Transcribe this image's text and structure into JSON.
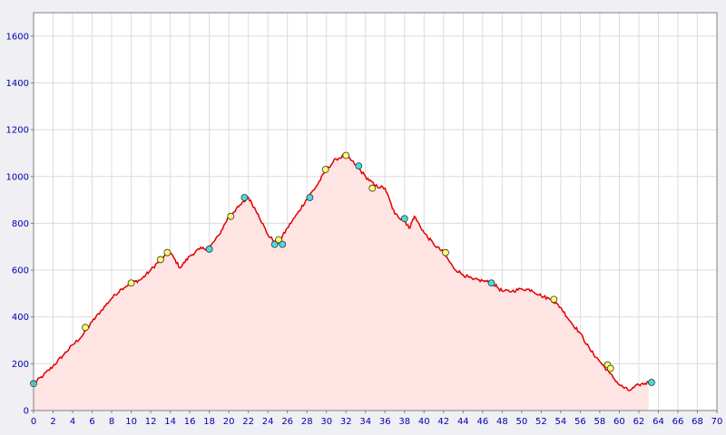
{
  "chart_data": {
    "type": "area",
    "title": "",
    "xlabel": "",
    "ylabel": "",
    "xlim": [
      0,
      70
    ],
    "ylim": [
      0,
      1700
    ],
    "x_ticks": [
      "0",
      "2",
      "4",
      "6",
      "8",
      "10",
      "12",
      "14",
      "16",
      "18",
      "20",
      "22",
      "24",
      "26",
      "28",
      "30",
      "32",
      "34",
      "36",
      "38",
      "40",
      "42",
      "44",
      "46",
      "48",
      "50",
      "52",
      "54",
      "56",
      "58",
      "60",
      "62",
      "64",
      "66",
      "68",
      "70"
    ],
    "y_ticks": [
      "0",
      "200",
      "400",
      "600",
      "800",
      "1000",
      "1200",
      "1400",
      "1600"
    ],
    "grid": true,
    "colors": {
      "line": "#e00000",
      "fill": "#ffe4e4",
      "plot_bg": "#ffffff",
      "page_bg": "#efeff4",
      "grid": "#dcdcdc",
      "marker_yellow": "#ffff66",
      "marker_cyan": "#44dddd"
    },
    "series": [
      {
        "x": [
          0,
          1,
          2,
          3,
          4,
          5,
          6,
          7,
          8,
          9,
          10,
          11,
          12,
          13,
          14,
          15,
          16,
          17,
          18,
          19,
          20,
          21,
          22,
          23,
          24,
          25,
          26,
          27,
          28,
          29,
          30,
          31,
          32,
          33,
          34,
          35,
          36,
          37,
          38,
          38.5,
          39,
          40,
          41,
          42,
          43,
          44,
          45,
          46,
          47,
          48,
          49,
          50,
          51,
          52,
          53,
          54,
          55,
          56,
          57,
          58,
          59,
          60,
          61,
          62,
          63
        ],
        "values": [
          115,
          150,
          190,
          235,
          280,
          320,
          380,
          430,
          480,
          520,
          545,
          560,
          600,
          645,
          675,
          610,
          660,
          690,
          695,
          750,
          830,
          870,
          910,
          840,
          750,
          710,
          780,
          840,
          905,
          960,
          1030,
          1075,
          1090,
          1050,
          1000,
          960,
          950,
          840,
          810,
          780,
          830,
          760,
          710,
          675,
          610,
          580,
          560,
          555,
          545,
          510,
          510,
          520,
          515,
          490,
          475,
          440,
          380,
          330,
          260,
          210,
          160,
          110,
          85,
          110,
          120
        ]
      }
    ],
    "markers": [
      {
        "x": 0,
        "y": 115,
        "color": "cyan"
      },
      {
        "x": 5.3,
        "y": 355,
        "color": "yellow"
      },
      {
        "x": 10,
        "y": 545,
        "color": "yellow"
      },
      {
        "x": 13,
        "y": 645,
        "color": "yellow"
      },
      {
        "x": 13.7,
        "y": 675,
        "color": "yellow"
      },
      {
        "x": 18,
        "y": 690,
        "color": "cyan"
      },
      {
        "x": 20.2,
        "y": 830,
        "color": "yellow"
      },
      {
        "x": 21.6,
        "y": 910,
        "color": "cyan"
      },
      {
        "x": 24.7,
        "y": 710,
        "color": "cyan"
      },
      {
        "x": 25.1,
        "y": 730,
        "color": "yellow"
      },
      {
        "x": 25.5,
        "y": 710,
        "color": "cyan"
      },
      {
        "x": 28.3,
        "y": 910,
        "color": "cyan"
      },
      {
        "x": 29.9,
        "y": 1030,
        "color": "yellow"
      },
      {
        "x": 32,
        "y": 1090,
        "color": "yellow"
      },
      {
        "x": 33.3,
        "y": 1045,
        "color": "cyan"
      },
      {
        "x": 34.7,
        "y": 950,
        "color": "yellow"
      },
      {
        "x": 38,
        "y": 820,
        "color": "cyan"
      },
      {
        "x": 42.2,
        "y": 675,
        "color": "yellow"
      },
      {
        "x": 46.9,
        "y": 545,
        "color": "cyan"
      },
      {
        "x": 53.3,
        "y": 475,
        "color": "yellow"
      },
      {
        "x": 58.8,
        "y": 195,
        "color": "yellow"
      },
      {
        "x": 59.1,
        "y": 180,
        "color": "yellow"
      },
      {
        "x": 63.3,
        "y": 120,
        "color": "cyan"
      }
    ]
  }
}
